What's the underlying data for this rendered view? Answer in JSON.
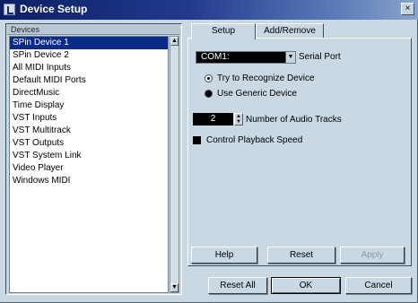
{
  "window": {
    "title": "Device Setup",
    "close_label": "×"
  },
  "devices": {
    "header": "Devices",
    "items": [
      "SPin Device 1",
      "SPin Device 2",
      "All MIDI Inputs",
      "Default MIDI Ports",
      "DirectMusic",
      "Time Display",
      "VST Inputs",
      "VST Multitrack",
      "VST Outputs",
      "VST System Link",
      "Video Player",
      "Windows MIDI"
    ],
    "selected_index": 0,
    "scroll_up_icon": "triangle-up",
    "scroll_down_icon": "triangle-down"
  },
  "tabs": [
    {
      "label": "Setup",
      "active": true
    },
    {
      "label": "Add/Remove",
      "active": false
    }
  ],
  "setup": {
    "serial_port_value": "COM1:",
    "serial_port_label": "Serial Port",
    "radio_recognize": "Try to Recognize Device",
    "radio_generic": "Use Generic Device",
    "audio_tracks_value": "2",
    "audio_tracks_label": "Number of Audio Tracks",
    "control_playback_label": "Control Playback Speed"
  },
  "panel_buttons": {
    "help": "Help",
    "reset": "Reset",
    "apply": "Apply"
  },
  "dialog_buttons": {
    "reset_all": "Reset All",
    "ok": "OK",
    "cancel": "Cancel"
  },
  "colors": {
    "title_bar": "#0c1e66",
    "selection": "#0a2a8a",
    "window_bg": "#c9d8e2"
  }
}
